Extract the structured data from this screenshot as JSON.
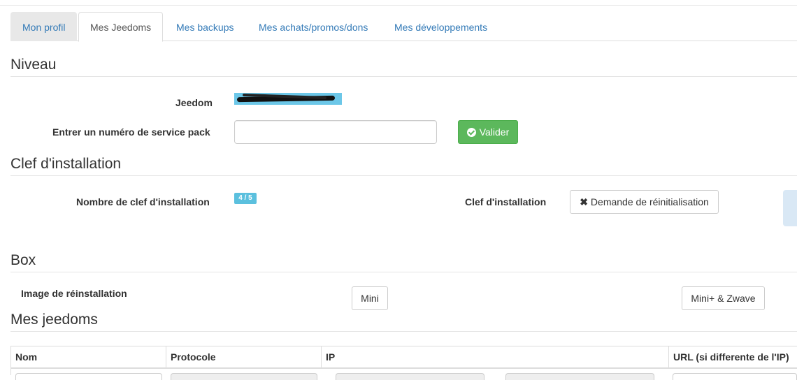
{
  "tabs": [
    {
      "label": "Mon profil"
    },
    {
      "label": "Mes Jeedoms"
    },
    {
      "label": "Mes backups"
    },
    {
      "label": "Mes achats/promos/dons"
    },
    {
      "label": "Mes développements"
    }
  ],
  "active_tab": "Mes Jeedoms",
  "niveau": {
    "title": "Niveau",
    "jeedom_label": "Jeedom",
    "service_pack_label": "Entrer un numéro de service pack",
    "service_pack_value": "",
    "validate_label": "Valider"
  },
  "clef": {
    "title": "Clef d'installation",
    "count_label": "Nombre de clef d'installation",
    "count_value": "4 / 5",
    "key_label": "Clef d'installation",
    "reset_label": "Demande de réinitialisation"
  },
  "box": {
    "title": "Box",
    "image_label": "Image de réinstallation",
    "mini_label": "Mini",
    "miniplus_label": "Mini+ & Zwave"
  },
  "mes_jeedoms": {
    "title": "Mes jeedoms",
    "columns": [
      "Nom",
      "Protocole",
      "IP",
      "URL (si differente de l'IP)"
    ]
  },
  "icons": {
    "validate": "check-circle-icon",
    "reset": "times-icon"
  },
  "colors": {
    "success": "#5cb85c",
    "info": "#5bc0de",
    "link": "#337ab7"
  }
}
